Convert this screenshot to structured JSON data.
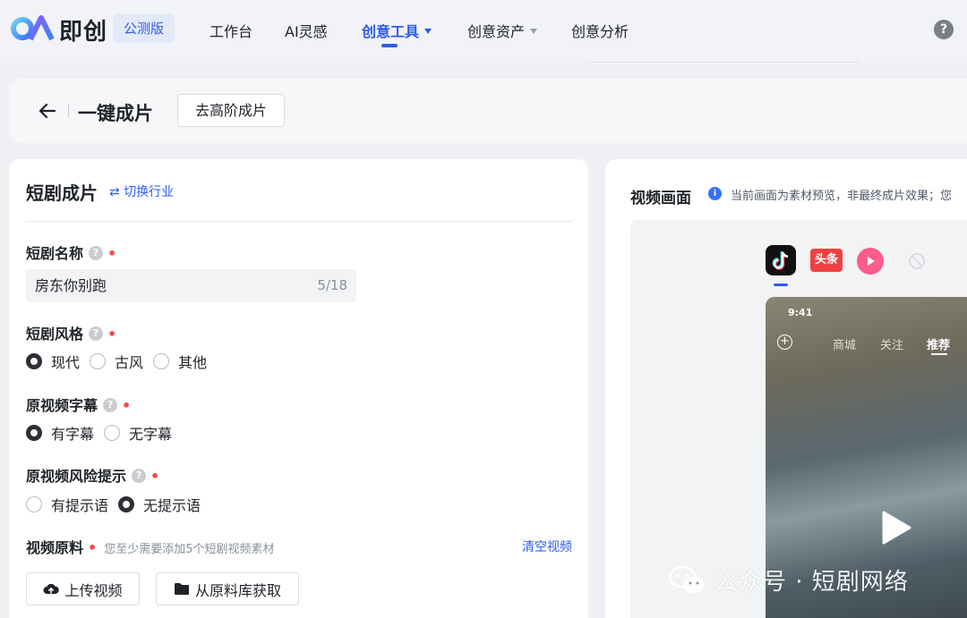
{
  "nav": {
    "brand": "即创",
    "beta": "公测版",
    "items": [
      {
        "label": "工作台"
      },
      {
        "label": "AI灵感"
      },
      {
        "label": "创意工具"
      },
      {
        "label": "创意资产"
      },
      {
        "label": "创意分析"
      }
    ],
    "help_icon": "question-circle-icon",
    "accent": "#2f5bea"
  },
  "header": {
    "title": "一键成片",
    "advanced_button": "去高阶成片"
  },
  "form": {
    "title": "短剧成片",
    "switch_link": "切换行业",
    "name": {
      "label": "短剧名称",
      "value": "房东你别跑",
      "counter": "5/18"
    },
    "style": {
      "label": "短剧风格",
      "options": [
        "现代",
        "古风",
        "其他"
      ],
      "selected": "现代"
    },
    "subtitle": {
      "label": "原视频字幕",
      "options": [
        "有字幕",
        "无字幕"
      ],
      "selected": "有字幕"
    },
    "risk": {
      "label": "原视频风险提示",
      "options": [
        "有提示语",
        "无提示语"
      ],
      "selected": "无提示语"
    },
    "video": {
      "label": "视频原料",
      "hint": "您至少需要添加5个短剧视频素材",
      "clear": "清空视频",
      "upload_button": "上传视频",
      "library_button": "从原料库获取"
    }
  },
  "preview": {
    "title": "视频画面",
    "info": "当前画面为素材预览，非最终成片效果；您",
    "platforms": [
      "douyin-icon",
      "头条",
      "xigua-icon",
      "ban-icon"
    ],
    "phone": {
      "time": "9:41",
      "tabs": [
        "商城",
        "关注",
        "推荐"
      ],
      "active_tab": "推荐"
    }
  },
  "watermark": {
    "text": "公众号 · 短剧网络"
  }
}
